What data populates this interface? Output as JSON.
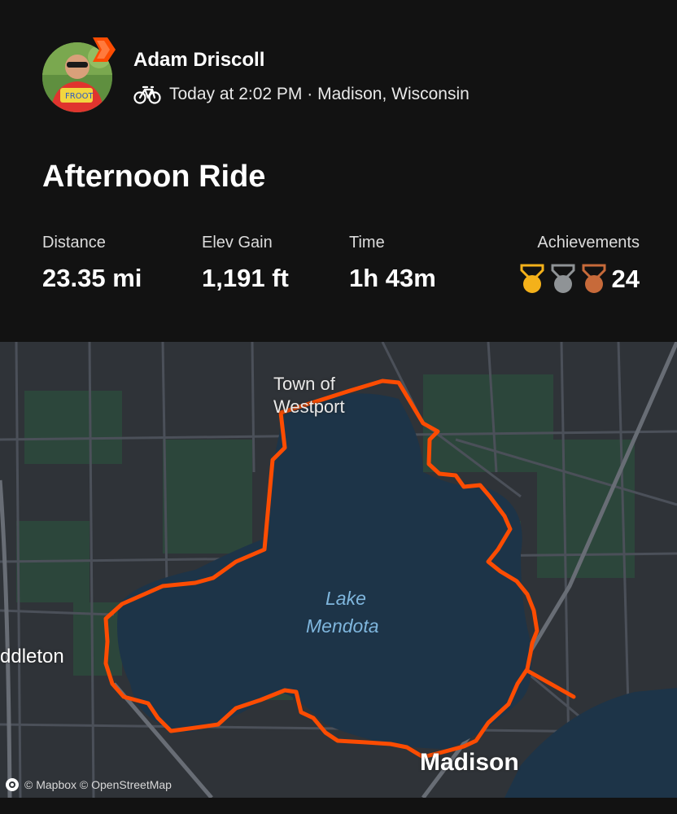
{
  "athlete": {
    "name": "Adam Driscoll",
    "avatar_icon": "profile-photo",
    "badge_icon": "subscriber-chevron-badge",
    "badge_color": "#fc4c02"
  },
  "activity": {
    "sport_icon": "bike-icon",
    "meta": "Today at 2:02 PM · Madison, Wisconsin",
    "title": "Afternoon Ride"
  },
  "stats": {
    "distance": {
      "label": "Distance",
      "value": "23.35 mi"
    },
    "elev_gain": {
      "label": "Elev Gain",
      "value": "1,191 ft"
    },
    "time": {
      "label": "Time",
      "value": "1h 43m"
    },
    "achievements": {
      "label": "Achievements",
      "value": "24",
      "medals": [
        {
          "name": "gold-medal-icon",
          "color": "#f4b11a"
        },
        {
          "name": "silver-medal-icon",
          "color": "#8f9396"
        },
        {
          "name": "bronze-medal-icon",
          "color": "#c76a3a"
        }
      ]
    }
  },
  "map": {
    "route_color": "#fc4c02",
    "water_color": "#1d3448",
    "labels": {
      "town": "Town of Westport",
      "lake_line1": "Lake",
      "lake_line2": "Mendota",
      "city": "Madison",
      "middleton": "ddleton"
    },
    "attribution": "© Mapbox © OpenStreetMap"
  }
}
